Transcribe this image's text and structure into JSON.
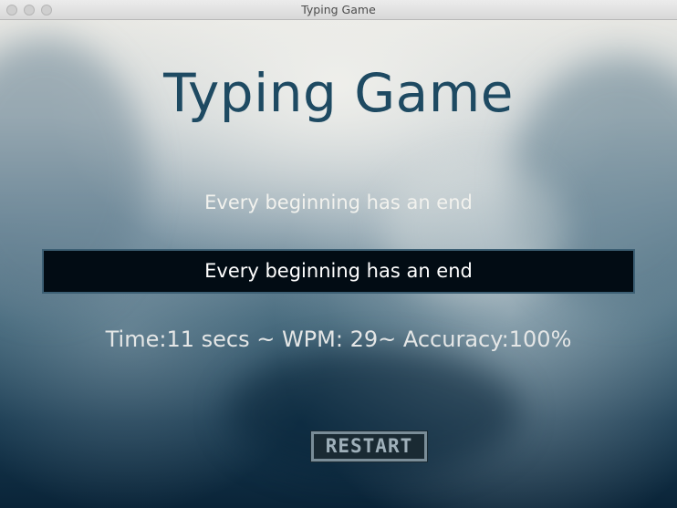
{
  "window": {
    "title": "Typing Game"
  },
  "game": {
    "title": "Typing Game",
    "target_sentence": "Every beginning has an end",
    "typed_text": "Every beginning has an end",
    "stats": "Time:11 secs ~ WPM: 29~ Accuracy:100%",
    "restart_label": "RESTART"
  },
  "colors": {
    "title_text": "#1e4a62",
    "input_background": "#020c14",
    "input_border": "#3c5f74",
    "stats_text": "#e4e6e6",
    "button_border": "#7a8d98"
  }
}
